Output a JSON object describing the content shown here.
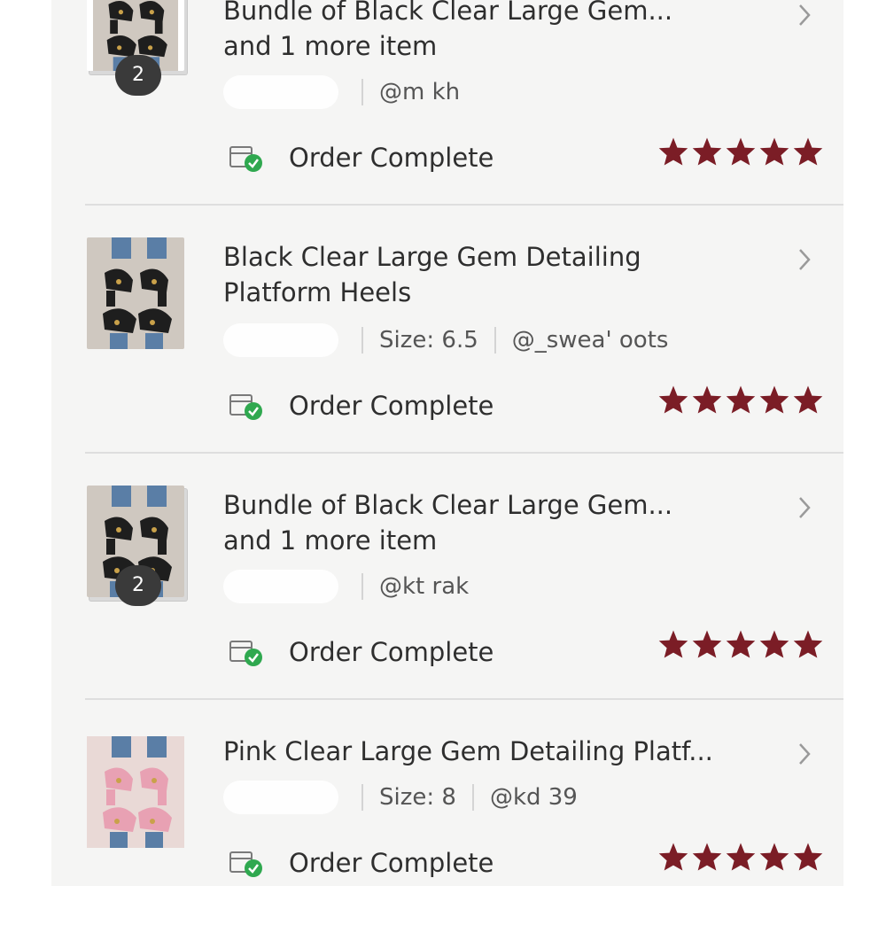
{
  "orders": [
    {
      "title_line1": "Bundle of Black Clear Large Gem...",
      "title_line2": "and 1 more item",
      "size": "",
      "seller": "@m      kh",
      "status": "Order Complete",
      "bundle_count": "2",
      "rating": 5,
      "shoe_color": "black"
    },
    {
      "title_line1": "Black Clear Large Gem Detailing",
      "title_line2": "Platform Heels",
      "size": "Size: 6.5",
      "seller": "@_swea'      oots",
      "status": "Order Complete",
      "bundle_count": "",
      "rating": 5,
      "shoe_color": "black"
    },
    {
      "title_line1": "Bundle of Black Clear Large Gem...",
      "title_line2": "and 1 more item",
      "size": "",
      "seller": "@kt   rak",
      "status": "Order Complete",
      "bundle_count": "2",
      "rating": 5,
      "shoe_color": "black"
    },
    {
      "title_line1": "Pink Clear Large Gem Detailing Platf...",
      "title_line2": "",
      "size": "Size: 8",
      "seller": "@kd      39",
      "status": "Order Complete",
      "bundle_count": "",
      "rating": 5,
      "shoe_color": "pink"
    }
  ],
  "colors": {
    "star": "#7b1d26",
    "status_check": "#2fa84f",
    "chevron": "#9a9a9a"
  },
  "icons": {
    "status": "package-check-icon",
    "chevron": "chevron-right-icon",
    "star": "star-icon"
  }
}
